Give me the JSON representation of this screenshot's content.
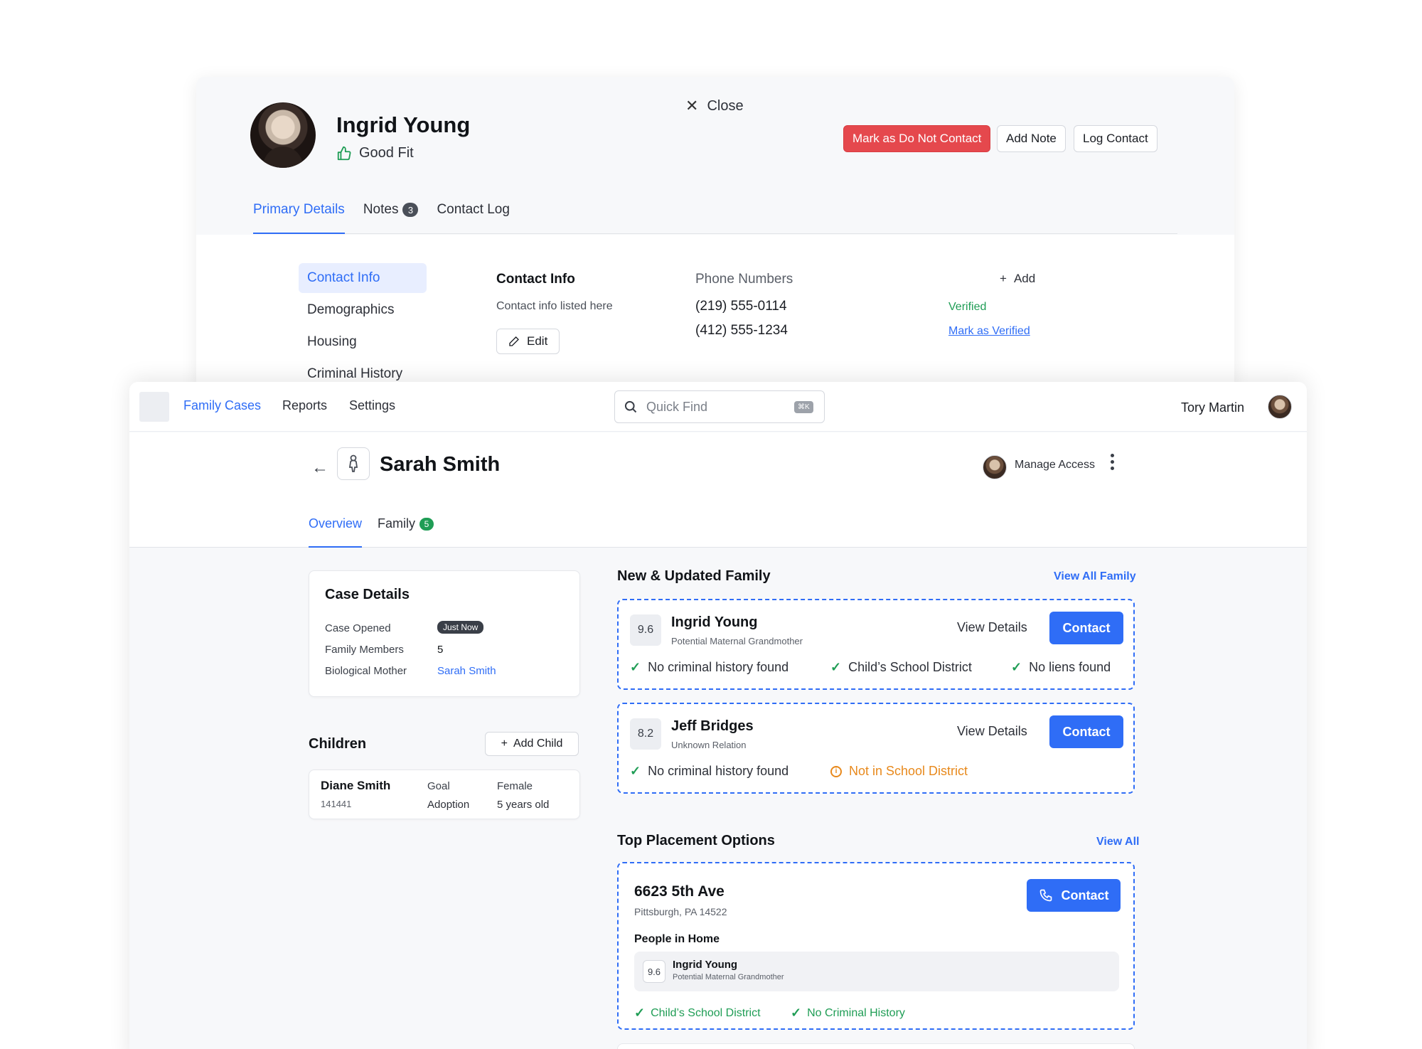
{
  "contact_panel": {
    "name": "Ingrid Young",
    "fit_label": "Good Fit",
    "close_label": "Close",
    "actions": {
      "do_not_contact": "Mark as Do Not Contact",
      "add_note": "Add Note",
      "log_contact": "Log Contact"
    },
    "tabs": [
      {
        "label": "Primary Details"
      },
      {
        "label": "Notes",
        "count": "3"
      },
      {
        "label": "Contact Log"
      }
    ],
    "side_nav": [
      "Contact Info",
      "Demographics",
      "Housing",
      "Criminal History"
    ],
    "contact_info": {
      "title": "Contact Info",
      "subtitle": "Contact info listed here",
      "edit_label": "Edit"
    },
    "phone_numbers": {
      "title": "Phone Numbers",
      "add_label": "Add",
      "items": [
        {
          "number": "(219) 555-0114",
          "status": "Verified"
        },
        {
          "number": "(412) 555-1234",
          "action": "Mark as Verified"
        }
      ]
    }
  },
  "app": {
    "nav": [
      "Family Cases",
      "Reports",
      "Settings"
    ],
    "search": {
      "placeholder": "Quick Find",
      "shortcut": "⌘K"
    },
    "user_name": "Tory Martin"
  },
  "case": {
    "title": "Sarah Smith",
    "manage_access": "Manage Access",
    "tabs": [
      {
        "label": "Overview"
      },
      {
        "label": "Family",
        "count": "5"
      }
    ],
    "details": {
      "title": "Case Details",
      "rows": [
        {
          "label": "Case Opened",
          "value": "Just Now"
        },
        {
          "label": "Family Members",
          "value": "5"
        },
        {
          "label": "Biological Mother",
          "value": "Sarah Smith"
        }
      ]
    },
    "children": {
      "title": "Children",
      "add_label": "Add Child",
      "items": [
        {
          "name": "Diane Smith",
          "id": "141441",
          "goal_label": "Goal",
          "goal": "Adoption",
          "gender": "Female",
          "age": "5 years old"
        }
      ]
    },
    "family": {
      "title": "New & Updated Family",
      "view_all": "View All Family",
      "view_details": "View Details",
      "contact_label": "Contact",
      "members": [
        {
          "score": "9.6",
          "name": "Ingrid Young",
          "relation": "Potential Maternal Grandmother",
          "checks": [
            "No criminal history found",
            "Child’s School District",
            "No liens found"
          ]
        },
        {
          "score": "8.2",
          "name": "Jeff Bridges",
          "relation": "Unknown Relation",
          "checks": [
            "No criminal history found"
          ],
          "warnings": [
            "Not in School District"
          ]
        }
      ]
    },
    "placements": {
      "title": "Top Placement Options",
      "view_all": "View All",
      "items": [
        {
          "address": "6623 5th Ave",
          "city": "Pittsburgh, PA 14522",
          "contact_label": "Contact",
          "people_title": "People in Home",
          "people": [
            {
              "score": "9.6",
              "name": "Ingrid Young",
              "relation": "Potential Maternal Grandmother"
            }
          ],
          "checks": [
            "Child’s School District",
            "No Criminal History"
          ]
        }
      ]
    }
  },
  "colors": {
    "accent": "#2f6df6",
    "danger": "#e5484d",
    "success": "#1f9d55",
    "warning": "#e8891c"
  }
}
